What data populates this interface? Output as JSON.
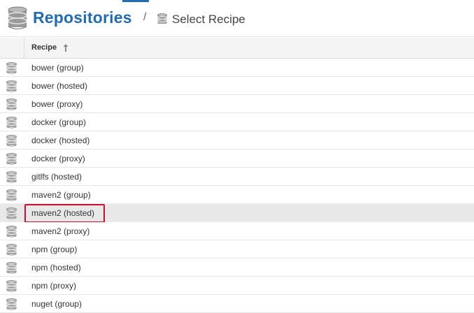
{
  "header": {
    "title": "Repositories",
    "separator": "/",
    "breadcrumb": "Select Recipe"
  },
  "table": {
    "column_header": "Recipe",
    "sort": "ascending",
    "rows": [
      "bower (group)",
      "bower (hosted)",
      "bower (proxy)",
      "docker (group)",
      "docker (hosted)",
      "docker (proxy)",
      "gitlfs (hosted)",
      "maven2 (group)",
      "maven2 (hosted)",
      "maven2 (proxy)",
      "npm (group)",
      "npm (hosted)",
      "npm (proxy)",
      "nuget (group)"
    ],
    "selected_row": "maven2 (hosted)"
  },
  "colors": {
    "accent": "#1f6cb2",
    "highlight_border": "#c8102e",
    "selected_row_bg": "#e8e8e8"
  },
  "icons": {
    "header": "database-icon",
    "breadcrumb": "database-icon",
    "row": "database-icon",
    "sort": "arrow-up-icon"
  }
}
